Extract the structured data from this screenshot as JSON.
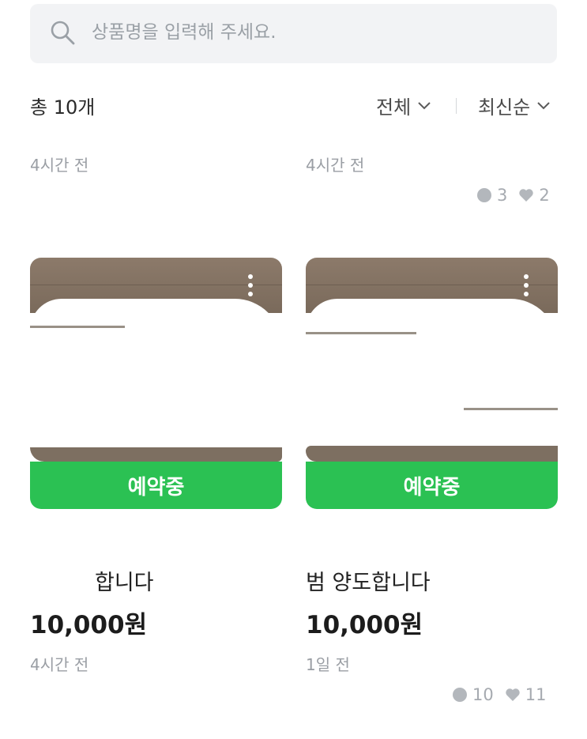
{
  "search": {
    "placeholder": "상품명을 입력해 주세요."
  },
  "toolbar": {
    "total": "총 10개",
    "filter_all": "전체",
    "sort": "최신순"
  },
  "top_row": [
    {
      "time": "4시간 전"
    },
    {
      "time": "4시간 전",
      "comments": "3",
      "likes": "2"
    }
  ],
  "items": [
    {
      "status": "예약중",
      "title": "합니다",
      "price": "10,000원",
      "time": "4시간 전"
    },
    {
      "status": "예약중",
      "title": "범 양도합니다",
      "price": "10,000원",
      "time": "1일 전",
      "comments": "10",
      "likes": "11"
    }
  ],
  "colors": {
    "badge": "#2bc153",
    "muted": "#9a9ea4"
  },
  "icons": [
    "search-icon",
    "chevron-down-icon",
    "comment-icon",
    "heart-icon",
    "more-icon"
  ]
}
